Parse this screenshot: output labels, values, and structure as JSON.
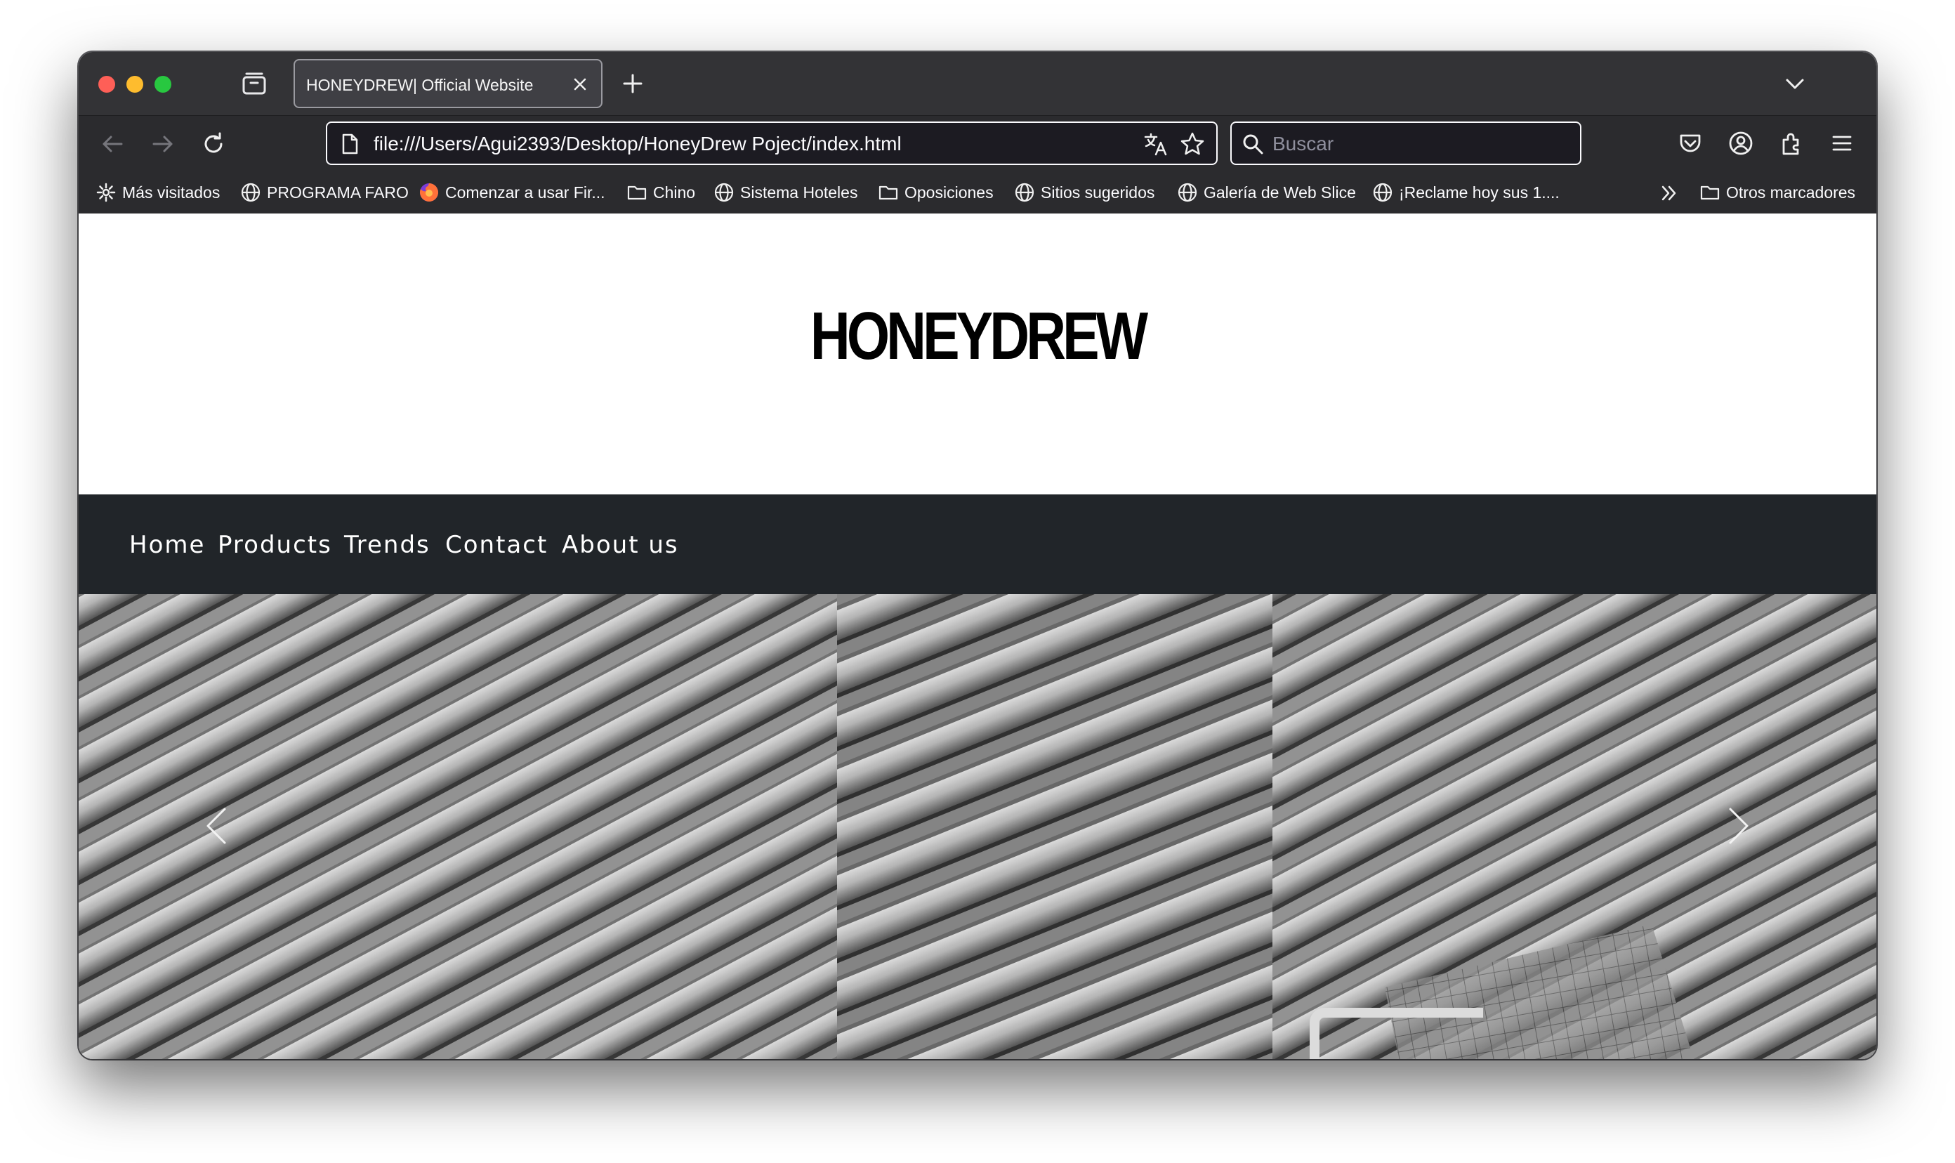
{
  "browser": {
    "tab": {
      "title": "HONEYDREW| Official Website"
    },
    "url": "file:///Users/Agui2393/Desktop/HoneyDrew Poject/index.html",
    "search": {
      "placeholder": "Buscar"
    },
    "bookmarks": [
      {
        "label": "Más visitados",
        "icon": "gear-icon"
      },
      {
        "label": "PROGRAMA FARO",
        "icon": "globe-icon"
      },
      {
        "label": "Comenzar a usar Fir...",
        "icon": "firefox-icon"
      },
      {
        "label": "Chino",
        "icon": "folder-icon"
      },
      {
        "label": "Sistema Hoteles",
        "icon": "globe-icon"
      },
      {
        "label": "Oposiciones",
        "icon": "folder-icon"
      },
      {
        "label": "Sitios sugeridos",
        "icon": "globe-icon"
      },
      {
        "label": "Galería de Web Slice",
        "icon": "globe-icon"
      },
      {
        "label": "¡Reclame hoy sus 1....",
        "icon": "globe-icon"
      }
    ],
    "other_bookmarks": "Otros marcadores"
  },
  "site": {
    "logo": "HONEYDREW",
    "nav": [
      "Home",
      "Products",
      "Trends",
      "Contact",
      "About us"
    ],
    "hero": {
      "image": "grayscale architectural facade with diagonal louvers"
    }
  },
  "colors": {
    "nav_background": "#212529",
    "browser_chrome": "#2b2b2e"
  }
}
